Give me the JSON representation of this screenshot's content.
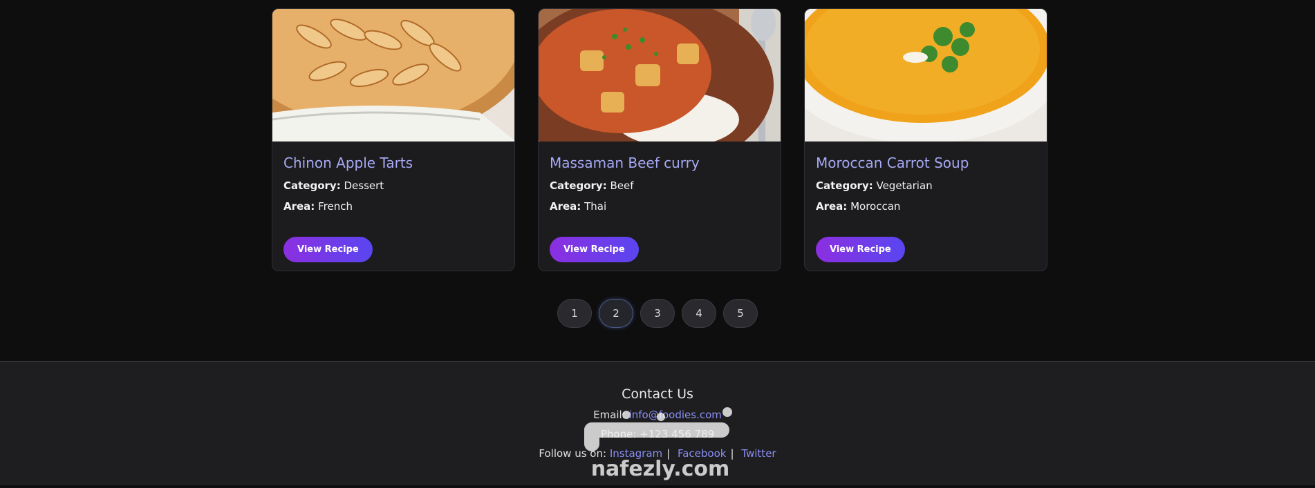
{
  "recipes": [
    {
      "title": "Chinon Apple Tarts",
      "category_label": "Category:",
      "category": "Dessert",
      "area_label": "Area:",
      "area": "French",
      "button": "View Recipe",
      "image": "apple-tart-image"
    },
    {
      "title": "Massaman Beef curry",
      "category_label": "Category:",
      "category": "Beef",
      "area_label": "Area:",
      "area": "Thai",
      "button": "View Recipe",
      "image": "beef-curry-image"
    },
    {
      "title": "Moroccan Carrot Soup",
      "category_label": "Category:",
      "category": "Vegetarian",
      "area_label": "Area:",
      "area": "Moroccan",
      "button": "View Recipe",
      "image": "carrot-soup-image"
    }
  ],
  "pagination": {
    "pages": [
      "1",
      "2",
      "3",
      "4",
      "5"
    ],
    "current": "2"
  },
  "footer": {
    "title": "Contact Us",
    "email_label": "Email:",
    "email": "info@foodies.com",
    "phone_label": "Phone:",
    "phone": "+123 456 789",
    "follow_label": "Follow us on:",
    "social": [
      "Instagram",
      "Facebook",
      "Twitter"
    ]
  },
  "watermark": {
    "text": "nafezly.com"
  },
  "colors": {
    "accent": "#a7a9f5",
    "button_start": "#8b2fe0",
    "button_end": "#5a46f0",
    "link": "#8b8ff5"
  }
}
